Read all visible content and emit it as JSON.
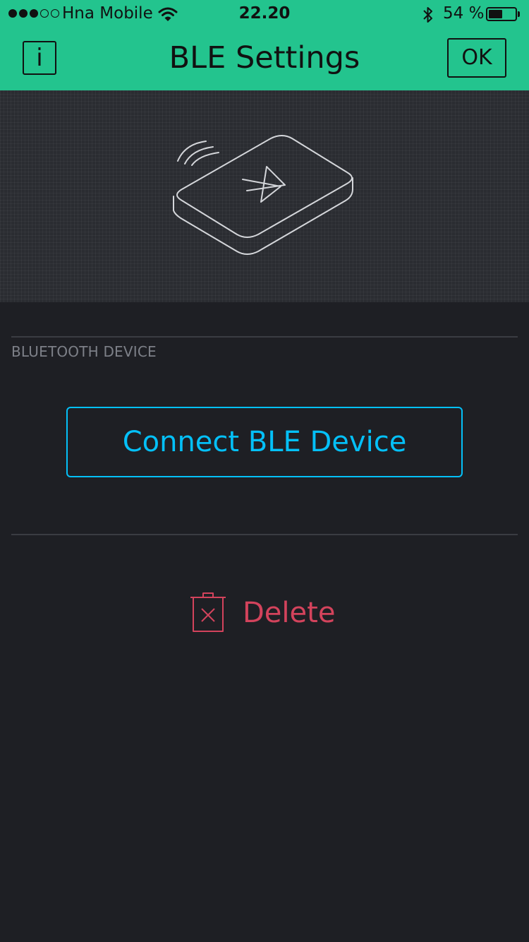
{
  "status_bar": {
    "carrier": "Hna Mobile",
    "time": "22.20",
    "battery_percent": "54 %",
    "battery_level": 0.54,
    "signal_bars": 3,
    "signal_total": 5,
    "wifi_icon": "wifi-icon",
    "bluetooth_icon": "bluetooth-icon"
  },
  "nav": {
    "info_label": "i",
    "title": "BLE Settings",
    "ok_label": "OK"
  },
  "illustration": {
    "icon": "ble-device-illustration"
  },
  "section": {
    "label": "BLUETOOTH DEVICE"
  },
  "actions": {
    "connect_label": "Connect BLE Device",
    "delete_label": "Delete",
    "delete_icon": "trash-icon"
  },
  "colors": {
    "header": "#23c48e",
    "background": "#1e1f24",
    "accent": "#04c0f8",
    "danger": "#d3435c"
  }
}
